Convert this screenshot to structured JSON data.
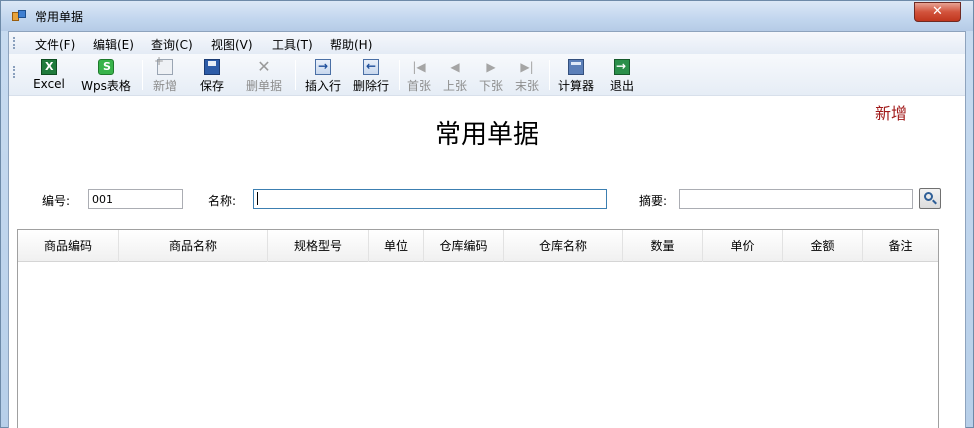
{
  "window": {
    "title": "常用单据",
    "close_glyph": "✕"
  },
  "menu": [
    "文件(F)",
    "编辑(E)",
    "查询(C)",
    "视图(V)",
    "工具(T)",
    "帮助(H)"
  ],
  "toolbar": {
    "excel": "Excel",
    "wps": "Wps表格",
    "new": "新增",
    "save": "保存",
    "delete_doc": "删单据",
    "insert_row": "插入行",
    "delete_row": "删除行",
    "first": "首张",
    "prev": "上张",
    "next": "下张",
    "last": "末张",
    "calculator": "计算器",
    "exit": "退出"
  },
  "form": {
    "mode": "新增",
    "title": "常用单据",
    "number_label": "编号:",
    "number_value": "001",
    "name_label": "名称:",
    "name_value": "",
    "summary_label": "摘要:",
    "summary_value": ""
  },
  "grid": {
    "columns": [
      "商品编码",
      "商品名称",
      "规格型号",
      "单位",
      "仓库编码",
      "仓库名称",
      "数量",
      "单价",
      "金额",
      "备注"
    ]
  }
}
